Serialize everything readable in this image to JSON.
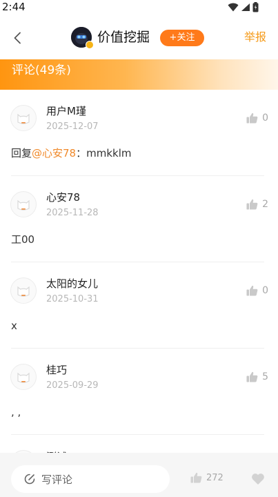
{
  "status_bar": {
    "time": "2:44"
  },
  "nav": {
    "title": "价值挖掘",
    "follow_label": "+关注",
    "report_label": "举报"
  },
  "section": {
    "title": "评论(49条)"
  },
  "comments": [
    {
      "name": "用户M瑾",
      "date": "2025-12-07",
      "likes": "0",
      "reply_prefix": "回复",
      "mention": "@心安78",
      "text": "：mmkklm"
    },
    {
      "name": "心安78",
      "date": "2025-11-28",
      "likes": "2",
      "text": "工00"
    },
    {
      "name": "太阳的女儿",
      "date": "2025-10-31",
      "likes": "0",
      "text": "x"
    },
    {
      "name": "桂巧",
      "date": "2025-09-29",
      "likes": "5",
      "text": ", ,"
    },
    {
      "name": "测试"
    }
  ],
  "bottom_bar": {
    "input_placeholder": "写评论",
    "like_total": "272"
  },
  "colors": {
    "accent_orange": "#ff7a1a",
    "report_orange": "#f59a19",
    "mention_orange": "#f0892a",
    "header_gradient_start": "#ff9510"
  }
}
